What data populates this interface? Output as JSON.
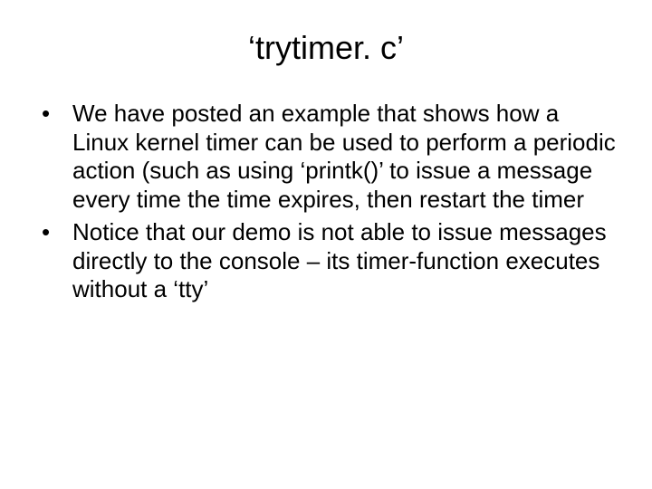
{
  "slide": {
    "title": "‘trytimer. c’",
    "bullets": [
      "We have posted an example that shows how a Linux kernel timer can be used to perform a periodic action (such as using ‘printk()’ to issue a message every time the time expires, then restart the timer",
      "Notice that our demo is not able to issue messages directly to the console – its timer-function executes without a ‘tty’"
    ]
  }
}
